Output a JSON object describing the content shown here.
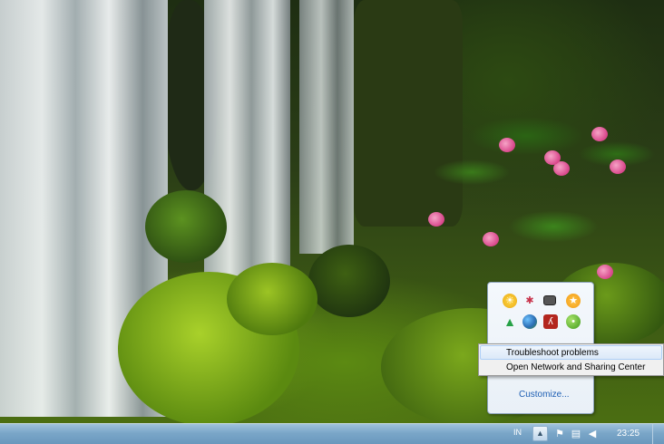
{
  "desktop": {
    "wallpaper": "waterfall with moss and pink rhododendron flowers"
  },
  "context_menu": {
    "items": [
      {
        "label": "Troubleshoot problems",
        "highlighted": true
      },
      {
        "label": "Open Network and Sharing Center",
        "highlighted": false
      }
    ]
  },
  "overflow_panel": {
    "icons": [
      {
        "icon": "sun-yellow-icon",
        "color": "#e9a911"
      },
      {
        "icon": "lady-bug-icon",
        "color": "#c8324a"
      },
      {
        "icon": "monitor-icon",
        "color": "#4a4a4a"
      },
      {
        "icon": "star-orange-icon",
        "color": "#f29b13"
      },
      {
        "icon": "green-triangle-icon",
        "color": "#26a146"
      },
      {
        "icon": "globe-network-icon",
        "color": "#3a8a3a"
      },
      {
        "icon": "acrobat-icon",
        "color": "#b3261e"
      },
      {
        "icon": "green-circle-icon",
        "color": "#5cb32a"
      }
    ],
    "customize_label": "Customize..."
  },
  "taskbar": {
    "language": "IN",
    "clock": "23:25",
    "tray_up_arrow": "▲",
    "tray_icons": [
      {
        "icon": "action-center-flag-icon"
      },
      {
        "icon": "network-icon"
      },
      {
        "icon": "volume-icon"
      }
    ]
  },
  "colors": {
    "taskbar": "#7aa6c8",
    "menu_highlight": "#dce9f8",
    "link": "#1e5fb4"
  }
}
